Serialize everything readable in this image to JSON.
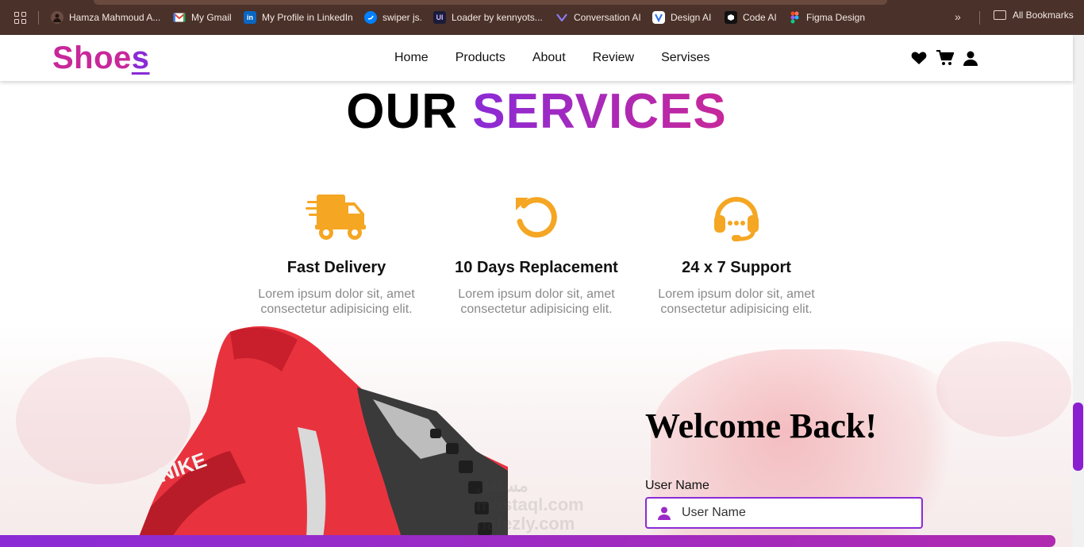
{
  "bookmarks_bar": {
    "apps_icon": "apps-grid-icon",
    "items": [
      {
        "label": "Hamza Mahmoud A...",
        "icon": "profile-photo-icon",
        "color": "#6b4d43"
      },
      {
        "label": "My Gmail",
        "icon": "gmail-icon",
        "color": "#ea4335"
      },
      {
        "label": "My Profile in LinkedIn",
        "icon": "linkedin-icon",
        "color": "#0a66c2"
      },
      {
        "label": "swiper js.",
        "icon": "swiper-icon",
        "color": "#0080ff"
      },
      {
        "label": "Loader by kennyots...",
        "icon": "uiverse-icon",
        "color": "#1b1b3a"
      },
      {
        "label": "Conversation AI",
        "icon": "conversation-ai-icon",
        "color": "#6c5ce7"
      },
      {
        "label": "Design AI",
        "icon": "design-ai-icon",
        "color": "#ffffff"
      },
      {
        "label": "Code AI",
        "icon": "code-ai-icon",
        "color": "#111111"
      },
      {
        "label": "Figma Design",
        "icon": "figma-icon",
        "color": "#f24e1e"
      }
    ],
    "more_icon": "chevron-double-right-icon",
    "all_bookmarks_label": "All Bookmarks"
  },
  "header": {
    "logo_main": "Shoe",
    "logo_last": "s",
    "nav": [
      "Home",
      "Products",
      "About",
      "Review",
      "Servises"
    ],
    "icons": [
      "heart-icon",
      "cart-icon",
      "user-icon"
    ]
  },
  "services": {
    "title_plain": "OUR",
    "title_accent": "SERVICES",
    "accent_color": "#f5a623",
    "items": [
      {
        "icon": "truck-icon",
        "title": "Fast Delivery",
        "text": "Lorem ipsum dolor sit, amet consectetur adipisicing elit."
      },
      {
        "icon": "rotate-icon",
        "title": "10 Days Replacement",
        "text": "Lorem ipsum dolor sit, amet consectetur adipisicing elit."
      },
      {
        "icon": "headset-icon",
        "title": "24 x 7 Support",
        "text": "Lorem ipsum dolor sit, amet consectetur adipisicing elit."
      }
    ]
  },
  "hero": {
    "shoe_brand": "NIKE",
    "watermark": [
      "مستقل",
      "mostaql.com",
      "nafezly.com"
    ]
  },
  "login": {
    "heading": "Welcome Back!",
    "username_label": "User Name",
    "username_placeholder": "User Name",
    "username_value": ""
  },
  "colors": {
    "brand_pink": "#c8289a",
    "brand_purple": "#8a2bd6",
    "bookmarks_bg": "#4a3129"
  }
}
